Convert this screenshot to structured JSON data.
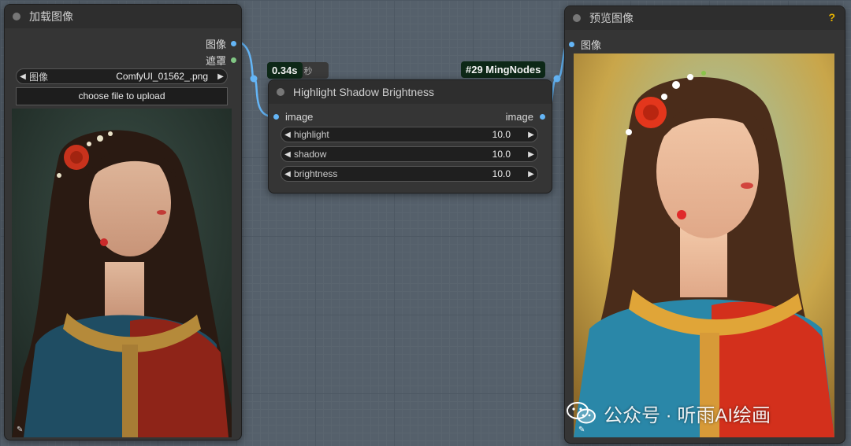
{
  "load_node": {
    "title": "加载图像",
    "outputs": [
      "图像",
      "遮罩"
    ],
    "image_widget": {
      "label": "图像",
      "value": "ComfyUI_01562_.png"
    },
    "upload_label": "choose file to upload"
  },
  "process_node": {
    "time_badge": "0.34s",
    "time_suffix": "秒",
    "id_badge": "#29 MingNodes",
    "title": "Highlight Shadow Brightness",
    "input_label": "image",
    "output_label": "image",
    "widgets": [
      {
        "name": "highlight",
        "value": "10.0"
      },
      {
        "name": "shadow",
        "value": "10.0"
      },
      {
        "name": "brightness",
        "value": "10.0"
      }
    ]
  },
  "preview_node": {
    "title": "预览图像",
    "help": "?",
    "input_label": "图像"
  },
  "watermark": {
    "text": "公众号 · 听雨AI绘画"
  },
  "colors": {
    "image_slot": "#64b5f6",
    "mask_slot": "#81c784",
    "link": "#64b5f6",
    "badge_bg": "#0d2817"
  }
}
